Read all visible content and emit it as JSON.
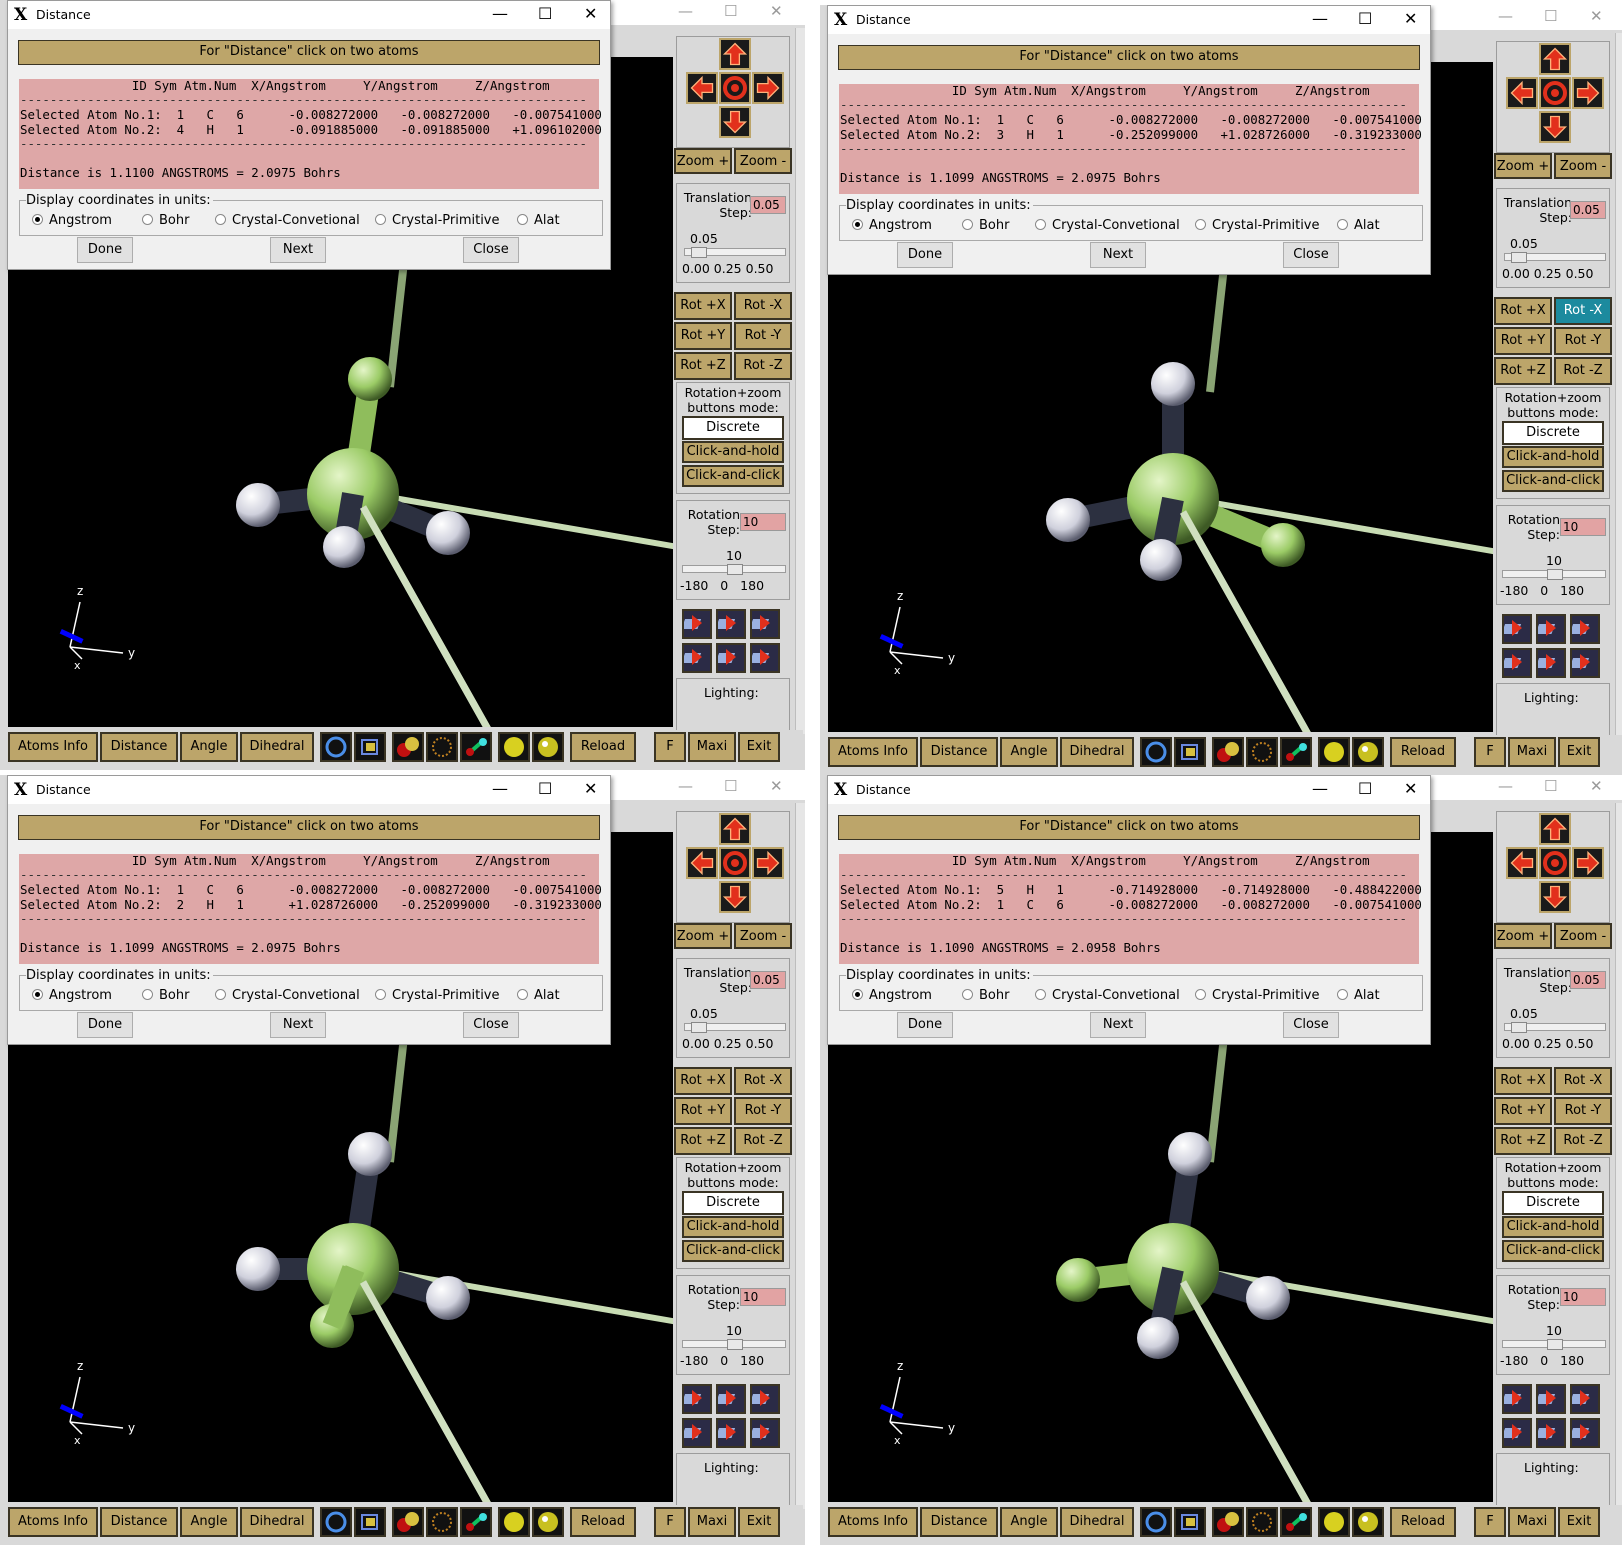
{
  "panels": [
    {
      "dialog": {
        "title": "Distance",
        "header": "For \"Distance\" click on two atoms",
        "columns": "               ID Sym Atm.Num  X/Angstrom     Y/Angstrom     Z/Angstrom",
        "atom1": "Selected Atom No.1:  1   C   6      -0.008272000   -0.008272000   -0.007541000",
        "atom2": "Selected Atom No.2:  4   H   1      -0.091885000   -0.091885000   +1.096102000",
        "distance": "Distance is 1.1100 ANGSTROMS = 2.0975 Bohrs",
        "active_rot": ""
      }
    },
    {
      "dialog": {
        "title": "Distance",
        "header": "For \"Distance\" click on two atoms",
        "columns": "               ID Sym Atm.Num  X/Angstrom     Y/Angstrom     Z/Angstrom",
        "atom1": "Selected Atom No.1:  1   C   6      -0.008272000   -0.008272000   -0.007541000",
        "atom2": "Selected Atom No.2:  3   H   1      -0.252099000   +1.028726000   -0.319233000",
        "distance": "Distance is 1.1099 ANGSTROMS = 2.0975 Bohrs",
        "active_rot": "rot-minus-x"
      }
    },
    {
      "dialog": {
        "title": "Distance",
        "header": "For \"Distance\" click on two atoms",
        "columns": "               ID Sym Atm.Num  X/Angstrom     Y/Angstrom     Z/Angstrom",
        "atom1": "Selected Atom No.1:  1   C   6      -0.008272000   -0.008272000   -0.007541000",
        "atom2": "Selected Atom No.2:  2   H   1      +1.028726000   -0.252099000   -0.319233000",
        "distance": "Distance is 1.1099 ANGSTROMS = 2.0975 Bohrs",
        "active_rot": ""
      }
    },
    {
      "dialog": {
        "title": "Distance",
        "header": "For \"Distance\" click on two atoms",
        "columns": "               ID Sym Atm.Num  X/Angstrom     Y/Angstrom     Z/Angstrom",
        "atom1": "Selected Atom No.1:  5   H   1      -0.714928000   -0.714928000   -0.488422000",
        "atom2": "Selected Atom No.2:  1   C   6      -0.008272000   -0.008272000   -0.007541000",
        "distance": "Distance is 1.1090 ANGSTROMS = 2.0958 Bohrs",
        "active_rot": ""
      }
    }
  ],
  "shared": {
    "units_legend": "Display coordinates in units:",
    "units": [
      "Angstrom",
      "Bohr",
      "Crystal-Convetional",
      "Crystal-Primitive",
      "Alat"
    ],
    "selected_unit": "Angstrom",
    "buttons": {
      "done": "Done",
      "next": "Next",
      "close": "Close"
    },
    "zoom_plus": "Zoom +",
    "zoom_minus": "Zoom -",
    "translation_label": "Translation\nStep:",
    "translation_value": "0.05",
    "translation_slider_value": "0.05",
    "translation_scale": "0.00 0.25 0.50",
    "rot": [
      "Rot +X",
      "Rot -X",
      "Rot +Y",
      "Rot -Y",
      "Rot +Z",
      "Rot -Z"
    ],
    "mode_label": "Rotation+zoom\nbuttons mode:",
    "modes": [
      "Discrete",
      "Click-and-hold",
      "Click-and-click"
    ],
    "rotation_label": "Rotation\nStep:",
    "rotation_value": "10",
    "rotation_slider_value": "10",
    "rotation_scale": "-180   0   180",
    "lighting_label": "Lighting:",
    "bottom": {
      "atoms_info": "Atoms Info",
      "distance": "Distance",
      "angle": "Angle",
      "dihedral": "Dihedral",
      "reload": "Reload",
      "f": "F",
      "maxi": "Maxi",
      "exit": "Exit"
    },
    "axes": {
      "z": "z",
      "y": "y",
      "x": "x"
    },
    "colors": {
      "gold": "#bca56a",
      "pink": "#dea7a7",
      "active": "#1c8a9e",
      "carbon": "#a9d27a",
      "hydrogen": "#e8e8ef"
    }
  }
}
